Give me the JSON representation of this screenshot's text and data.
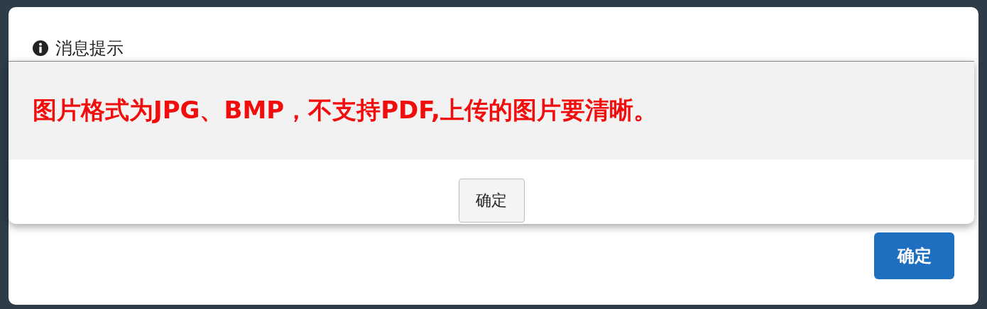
{
  "back_dialog": {
    "title": "消息提示",
    "button": "确定"
  },
  "front_dialog": {
    "message": "图片格式为JPG、BMP，不支持PDF,上传的图片要清晰。",
    "button": "确定"
  }
}
